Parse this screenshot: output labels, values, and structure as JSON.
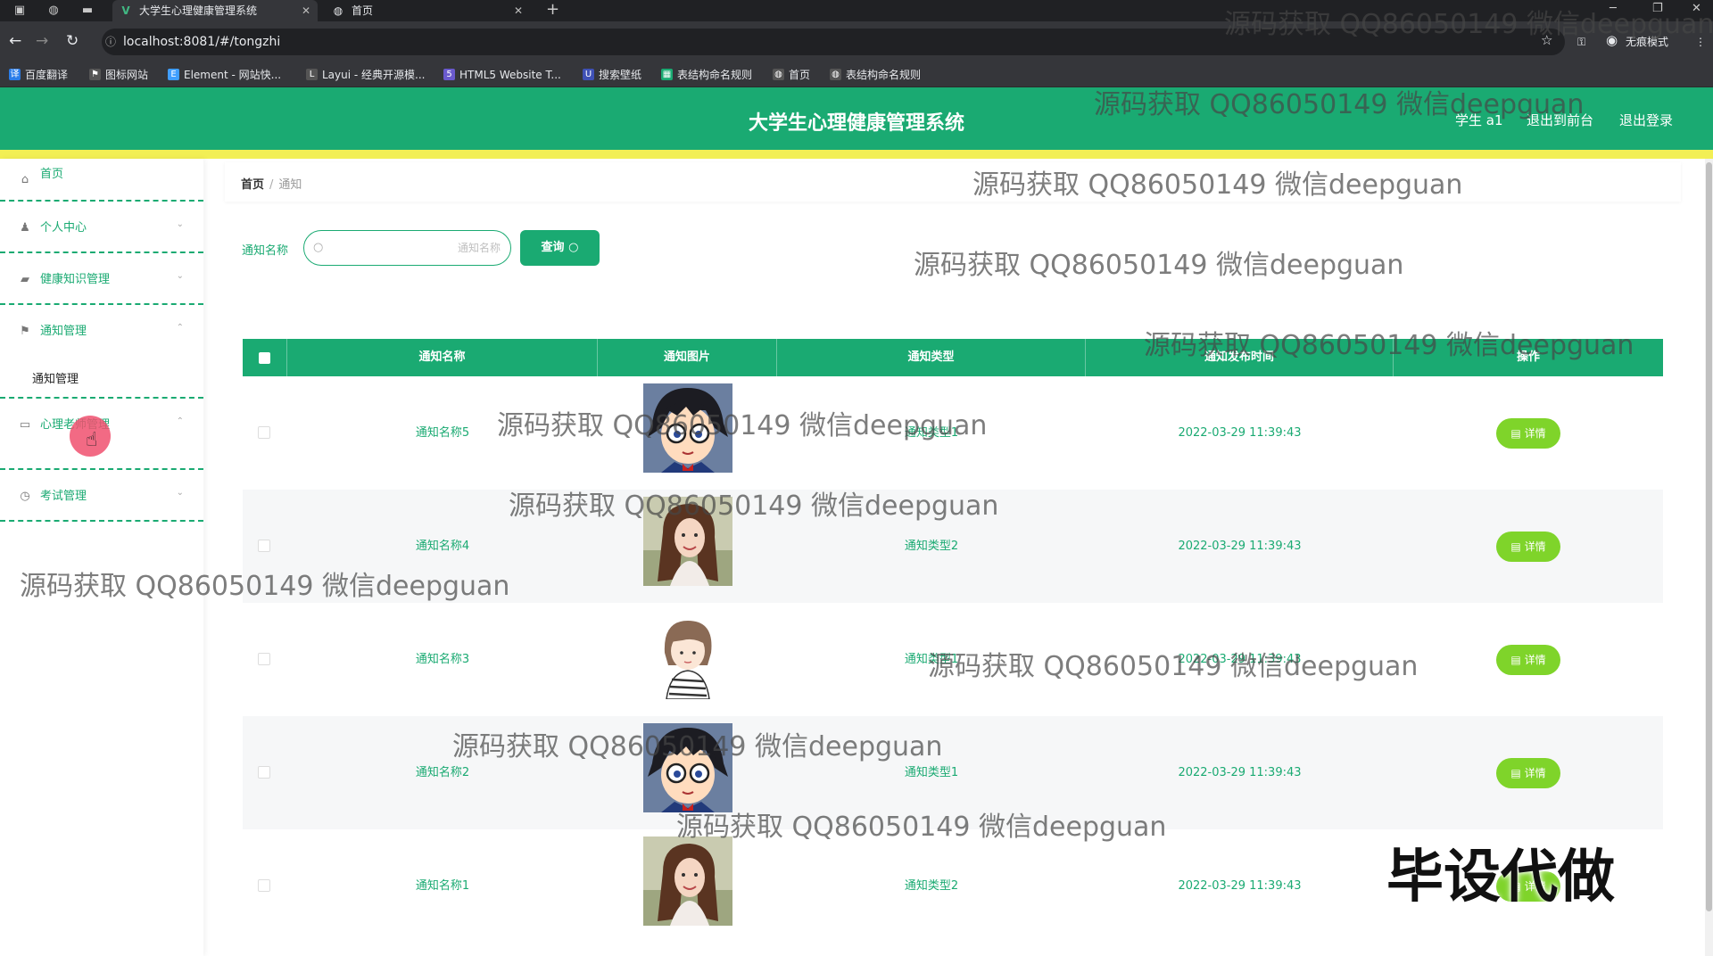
{
  "browser": {
    "tabs": [
      {
        "title": "大学生心理健康管理系统",
        "active": true
      },
      {
        "title": "首页",
        "active": false
      }
    ],
    "url": "localhost:8081/#/tongzhi",
    "incognito_label": "无痕模式",
    "bookmarks": [
      "百度翻译",
      "图标网站",
      "Element - 网站快...",
      "Layui - 经典开源模...",
      "HTML5 Website T...",
      "搜索壁纸",
      "表结构命名规则",
      "首页",
      "表结构命名规则"
    ]
  },
  "header": {
    "title": "大学生心理健康管理系统",
    "user": "学生 a1",
    "front_link": "退出到前台",
    "logout_link": "退出登录",
    "colors": {
      "primary": "#1aaa72",
      "strip": "#f2ef55"
    }
  },
  "sidebar": {
    "items": [
      {
        "label": "首页",
        "icon": "home-icon"
      },
      {
        "label": "个人中心",
        "icon": "user-icon"
      },
      {
        "label": "健康知识管理",
        "icon": "briefcase-icon"
      },
      {
        "label": "通知管理",
        "icon": "flag-icon"
      },
      {
        "label": "心理老师管理",
        "icon": "chat-icon"
      },
      {
        "label": "考试管理",
        "icon": "clock-icon"
      }
    ],
    "submenu_tongzhi": "通知管理"
  },
  "breadcrumb": {
    "home": "首页",
    "separator": "/",
    "current": "通知"
  },
  "search": {
    "label": "通知名称",
    "placeholder": "通知名称",
    "value": "",
    "button": "查询"
  },
  "table": {
    "headers": [
      "通知名称",
      "通知图片",
      "通知类型",
      "通知发布时间",
      "操作"
    ],
    "rows": [
      {
        "name": "通知名称5",
        "image": "anime-boy-avatar",
        "type": "通知类型1",
        "time": "2022-03-29 11:39:43",
        "action": "详情"
      },
      {
        "name": "通知名称4",
        "image": "woman-photo",
        "type": "通知类型2",
        "time": "2022-03-29 11:39:43",
        "action": "详情"
      },
      {
        "name": "通知名称3",
        "image": "cartoon-girl-avatar",
        "type": "通知类型1",
        "time": "2022-03-29 11:39:43",
        "action": "详情"
      },
      {
        "name": "通知名称2",
        "image": "anime-boy-avatar",
        "type": "通知类型1",
        "time": "2022-03-29 11:39:43",
        "action": "详情"
      },
      {
        "name": "通知名称1",
        "image": "woman-photo",
        "type": "通知类型2",
        "time": "2022-03-29 11:39:43",
        "action": "详情"
      }
    ]
  },
  "watermark": {
    "text": "源码获取 QQ86050149 微信deepguan",
    "badge": "毕设代做"
  }
}
